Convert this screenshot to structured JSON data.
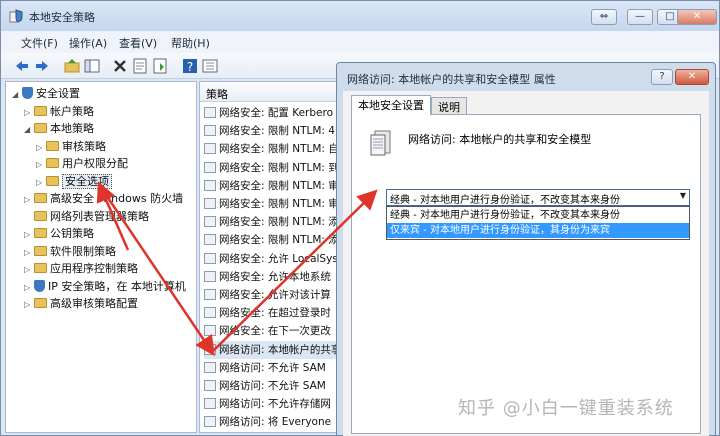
{
  "window": {
    "title": "本地安全策略",
    "caption_buttons": [
      "⇔",
      "—",
      "□",
      "✕"
    ]
  },
  "menu": [
    "文件(F)",
    "操作(A)",
    "查看(V)",
    "帮助(H)"
  ],
  "toolbar_icons": [
    "back-icon",
    "forward-icon",
    "up-folder-icon",
    "show-tree-icon",
    "delete-icon",
    "properties-icon",
    "export-icon",
    "help-icon",
    "view-icon"
  ],
  "tree": {
    "items": [
      {
        "label": "安全设置",
        "level": 0,
        "expander": "◢",
        "icon": "shield"
      },
      {
        "label": "帐户策略",
        "level": 1,
        "expander": "▷",
        "icon": "folder"
      },
      {
        "label": "本地策略",
        "level": 1,
        "expander": "◢",
        "icon": "folder"
      },
      {
        "label": "审核策略",
        "level": 2,
        "expander": "▷",
        "icon": "folder"
      },
      {
        "label": "用户权限分配",
        "level": 2,
        "expander": "▷",
        "icon": "folder"
      },
      {
        "label": "安全选项",
        "level": 2,
        "expander": "▷",
        "icon": "folder"
      },
      {
        "label": "高级安全 Windows 防火墙",
        "level": 1,
        "expander": "▷",
        "icon": "folder"
      },
      {
        "label": "网络列表管理器策略",
        "level": 1,
        "expander": "",
        "icon": "folder"
      },
      {
        "label": "公钥策略",
        "level": 1,
        "expander": "▷",
        "icon": "folder"
      },
      {
        "label": "软件限制策略",
        "level": 1,
        "expander": "▷",
        "icon": "folder"
      },
      {
        "label": "应用程序控制策略",
        "level": 1,
        "expander": "▷",
        "icon": "folder"
      },
      {
        "label": "IP 安全策略，在 本地计算机",
        "level": 1,
        "expander": "▷",
        "icon": "shield"
      },
      {
        "label": "高级审核策略配置",
        "level": 1,
        "expander": "▷",
        "icon": "folder"
      }
    ]
  },
  "policy_list": {
    "header": "策略",
    "rows": [
      "网络安全: 配置 Kerbero",
      "网络安全: 限制 NTLM: 4",
      "网络安全: 限制 NTLM: 自",
      "网络安全: 限制 NTLM: 到",
      "网络安全: 限制 NTLM: 审",
      "网络安全: 限制 NTLM: 审",
      "网络安全: 限制 NTLM: 添",
      "网络安全: 限制 NTLM: 添",
      "网络安全: 允许 LocalSys",
      "网络安全: 允许本地系统",
      "网络安全: 允许对该计算",
      "网络安全: 在超过登录时",
      "网络安全: 在下一次更改",
      "网络访问: 本地帐户的共享",
      "网络访问: 不允许 SAM",
      "网络访问: 不允许 SAM",
      "网络访问: 不允许存储网",
      "网络访问: 将 Everyone"
    ]
  },
  "dialog": {
    "title": "网络访问: 本地帐户的共享和安全模型 属性",
    "help_button": "?",
    "close_button": "✕",
    "tabs": [
      "本地安全设置",
      "说明"
    ],
    "policy_name": "网络访问: 本地帐户的共享和安全模型",
    "dropdown_value": "经典 - 对本地用户进行身份验证，不改变其本来身份",
    "dropdown_options": [
      "经典 - 对本地用户进行身份验证，不改变其本来身份",
      "仅来宾 - 对本地用户进行身份验证，其身份为来宾"
    ]
  },
  "watermark": "知乎 @小白一键重装系统",
  "colors": {
    "arrow": "#e0342a",
    "selection": "#3399ff",
    "titlebar": "#c5d7ee"
  }
}
